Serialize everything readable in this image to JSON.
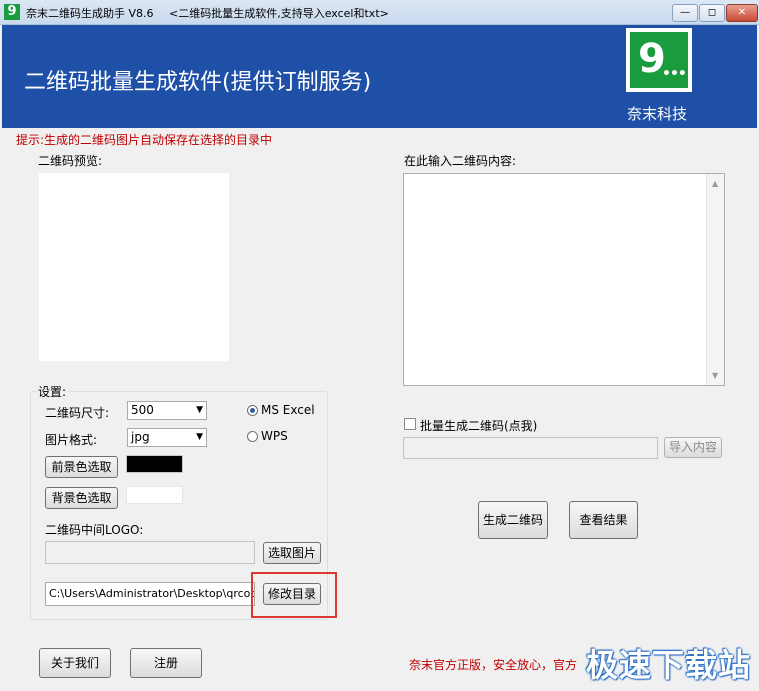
{
  "window": {
    "app_icon": "9",
    "title": "奈末二维码生成助手 V8.6",
    "subtitle": "<二维码批量生成软件,支持导入excel和txt>",
    "minimize_icon": "minimize-icon",
    "maximize_icon": "maximize-icon",
    "close_icon": "close-icon"
  },
  "header": {
    "title": "二维码批量生成软件(提供订制服务)",
    "logo_text": "9",
    "company": "奈末科技"
  },
  "tip": "提示:生成的二维码图片自动保存在选择的目录中",
  "preview": {
    "label": "二维码预览:"
  },
  "content": {
    "label": "在此输入二维码内容:",
    "value": ""
  },
  "settings": {
    "label": "设置:",
    "size_label": "二维码尺寸:",
    "size_value": "500",
    "format_label": "图片格式:",
    "format_value": "jpg",
    "radio_excel": "MS  Excel",
    "radio_wps": "WPS",
    "radio_selected": "MS Excel",
    "fg_button": "前景色选取",
    "fg_color": "#000000",
    "bg_button": "背景色选取",
    "bg_color": "#ffffff",
    "logo_label": "二维码中间LOGO:",
    "logo_path": "",
    "choose_image_button": "选取图片",
    "dir_path": "C:\\Users\\Administrator\\Desktop\\qrcod",
    "change_dir_button": "修改目录"
  },
  "batch": {
    "checkbox_label": "批量生成二维码(点我)",
    "checked": false,
    "import_button": "导入内容"
  },
  "actions": {
    "generate_button": "生成二维码",
    "view_button": "查看结果"
  },
  "footer": {
    "about_button": "关于我们",
    "register_button": "注册",
    "notice": "奈末官方正版，安全放心，官方",
    "watermark": "极速下载站"
  },
  "colors": {
    "header_bg": "#1f50a8",
    "accent_red": "#c00000",
    "highlight": "#d9392f"
  }
}
